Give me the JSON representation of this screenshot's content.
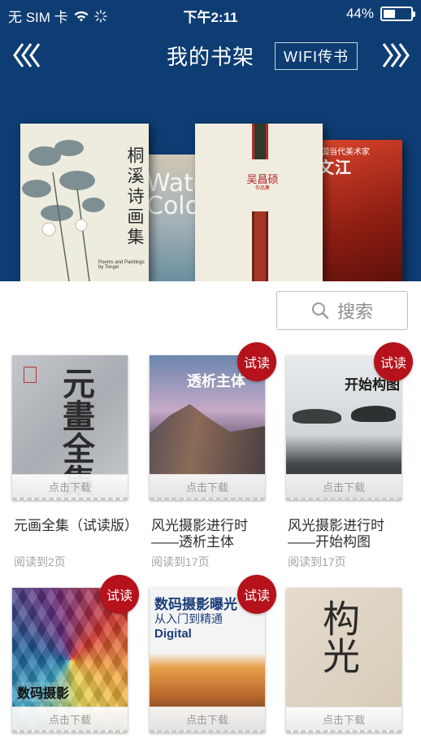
{
  "status_bar": {
    "carrier": "无 SIM 卡",
    "time": "下午2:11",
    "battery": "44%",
    "battery_level": 0.44
  },
  "nav": {
    "title": "我的书架",
    "wifi_button": "WIFI传书"
  },
  "banner": {
    "book1_title": "桐溪诗画集",
    "book1_subtitle": "Poems and Paintings by Tongxi",
    "book2_title": "Water Colour",
    "book3_title": "吴昌硕",
    "book3_subtitle": "作品集",
    "book4_title": "文江",
    "book4_series": "国当代美术家"
  },
  "search": {
    "label": "搜索"
  },
  "books": [
    {
      "title": "元画全集（试读版）",
      "progress": "阅读到2页",
      "download": "点击下载",
      "trial": false,
      "cover_text": "元畫全集"
    },
    {
      "title": "风光摄影进行时——透析主体",
      "progress": "阅读到17页",
      "download": "点击下载",
      "trial": true,
      "trial_label": "试读",
      "cover_text": "透析主体"
    },
    {
      "title": "风光摄影进行时——开始构图",
      "progress": "阅读到17页",
      "download": "点击下载",
      "trial": true,
      "trial_label": "试读",
      "cover_text": "开始构图"
    },
    {
      "title": "",
      "progress": "",
      "download": "点击下载",
      "trial": true,
      "trial_label": "试读",
      "cover_text": "数码摄影"
    },
    {
      "title": "",
      "progress": "",
      "download": "点击下载",
      "trial": true,
      "trial_label": "试读",
      "cover_text": "数码摄影曝光",
      "cover_subtext": "从入门到精通",
      "cover_tag": "Digital"
    },
    {
      "title": "",
      "progress": "",
      "download": "点击下载",
      "trial": false,
      "cover_text": "构光"
    }
  ],
  "colors": {
    "header_bg": "#0e3d73",
    "trial_badge": "#b5121b"
  }
}
